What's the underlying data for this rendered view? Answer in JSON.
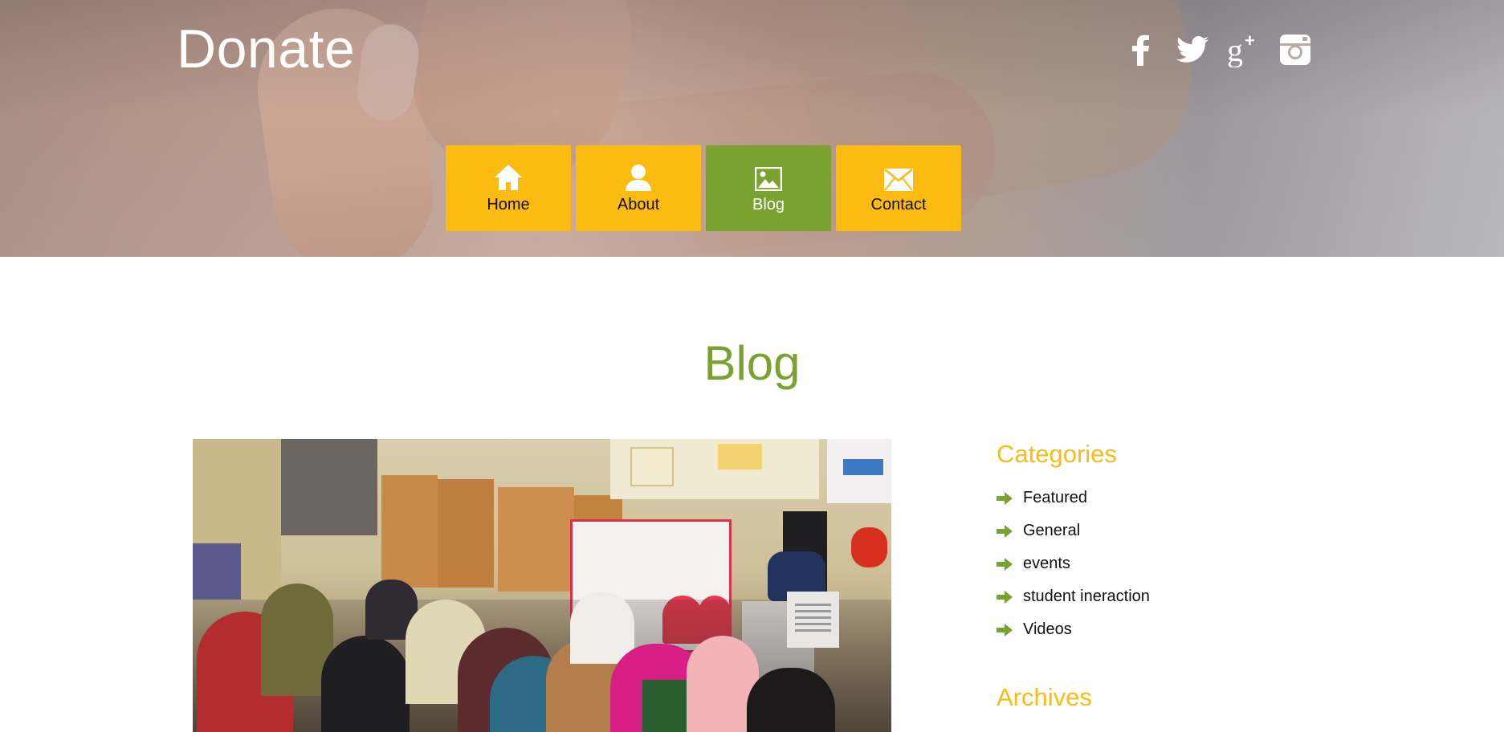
{
  "colors": {
    "accent_yellow": "#fbbb10",
    "accent_green": "#7aa22f",
    "header_text": "#ffffff",
    "body_text": "#111111"
  },
  "site": {
    "title": "Donate"
  },
  "social": [
    {
      "name": "facebook",
      "icon": "facebook-icon"
    },
    {
      "name": "twitter",
      "icon": "twitter-icon"
    },
    {
      "name": "google-plus",
      "icon": "google-plus-icon"
    },
    {
      "name": "instagram",
      "icon": "instagram-icon"
    }
  ],
  "nav": {
    "items": [
      {
        "label": "Home",
        "icon": "home-icon",
        "active": false
      },
      {
        "label": "About",
        "icon": "user-icon",
        "active": false
      },
      {
        "label": "Blog",
        "icon": "image-icon",
        "active": true
      },
      {
        "label": "Contact",
        "icon": "envelope-icon",
        "active": false
      }
    ]
  },
  "main": {
    "page_title": "Blog",
    "featured_image": {
      "icon": "blog-post-photo"
    }
  },
  "sidebar": {
    "categories_title": "Categories",
    "categories": [
      "Featured",
      "General",
      "events",
      "student ineraction",
      "Videos"
    ],
    "archives_title": "Archives"
  }
}
